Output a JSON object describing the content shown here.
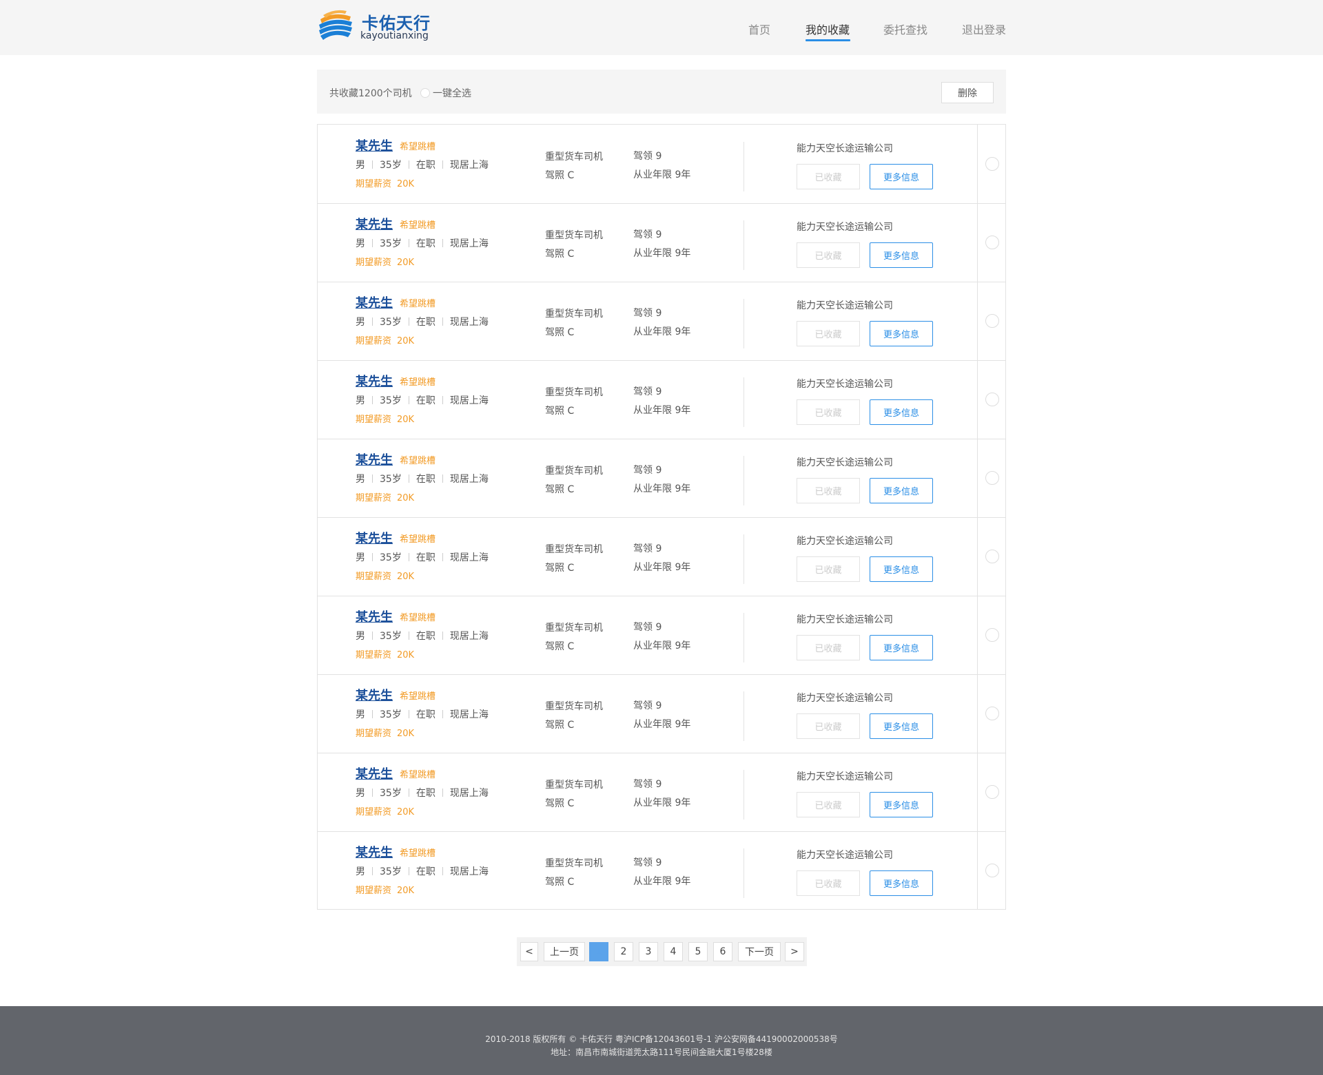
{
  "brand": {
    "name": "卡佑天行",
    "pinyin": "kayoutianxing"
  },
  "nav": [
    {
      "label": "首页",
      "active": false
    },
    {
      "label": "我的收藏",
      "active": true
    },
    {
      "label": "委托查找",
      "active": false
    },
    {
      "label": "退出登录",
      "active": false
    }
  ],
  "toolbar": {
    "total_text": "共收藏1200个司机",
    "select_all_label": "一键全选",
    "delete_label": "删除"
  },
  "drivers": [
    {
      "name": "某先生",
      "tag": "希望跳槽",
      "gender": "男",
      "age": "35岁",
      "status": "在职",
      "location": "现居上海",
      "salary_label": "期望薪资",
      "salary": "20K",
      "job": "重型货车司机",
      "license": "驾照  C",
      "driving_age": "驾领  9",
      "experience": "从业年限  9年",
      "company": "能力天空长途运输公司",
      "collected_label": "已收藏",
      "more_label": "更多信息"
    },
    {
      "name": "某先生",
      "tag": "希望跳槽",
      "gender": "男",
      "age": "35岁",
      "status": "在职",
      "location": "现居上海",
      "salary_label": "期望薪资",
      "salary": "20K",
      "job": "重型货车司机",
      "license": "驾照  C",
      "driving_age": "驾领  9",
      "experience": "从业年限  9年",
      "company": "能力天空长途运输公司",
      "collected_label": "已收藏",
      "more_label": "更多信息"
    },
    {
      "name": "某先生",
      "tag": "希望跳槽",
      "gender": "男",
      "age": "35岁",
      "status": "在职",
      "location": "现居上海",
      "salary_label": "期望薪资",
      "salary": "20K",
      "job": "重型货车司机",
      "license": "驾照  C",
      "driving_age": "驾领  9",
      "experience": "从业年限  9年",
      "company": "能力天空长途运输公司",
      "collected_label": "已收藏",
      "more_label": "更多信息"
    },
    {
      "name": "某先生",
      "tag": "希望跳槽",
      "gender": "男",
      "age": "35岁",
      "status": "在职",
      "location": "现居上海",
      "salary_label": "期望薪资",
      "salary": "20K",
      "job": "重型货车司机",
      "license": "驾照  C",
      "driving_age": "驾领  9",
      "experience": "从业年限  9年",
      "company": "能力天空长途运输公司",
      "collected_label": "已收藏",
      "more_label": "更多信息"
    },
    {
      "name": "某先生",
      "tag": "希望跳槽",
      "gender": "男",
      "age": "35岁",
      "status": "在职",
      "location": "现居上海",
      "salary_label": "期望薪资",
      "salary": "20K",
      "job": "重型货车司机",
      "license": "驾照  C",
      "driving_age": "驾领  9",
      "experience": "从业年限  9年",
      "company": "能力天空长途运输公司",
      "collected_label": "已收藏",
      "more_label": "更多信息"
    },
    {
      "name": "某先生",
      "tag": "希望跳槽",
      "gender": "男",
      "age": "35岁",
      "status": "在职",
      "location": "现居上海",
      "salary_label": "期望薪资",
      "salary": "20K",
      "job": "重型货车司机",
      "license": "驾照  C",
      "driving_age": "驾领  9",
      "experience": "从业年限  9年",
      "company": "能力天空长途运输公司",
      "collected_label": "已收藏",
      "more_label": "更多信息"
    },
    {
      "name": "某先生",
      "tag": "希望跳槽",
      "gender": "男",
      "age": "35岁",
      "status": "在职",
      "location": "现居上海",
      "salary_label": "期望薪资",
      "salary": "20K",
      "job": "重型货车司机",
      "license": "驾照  C",
      "driving_age": "驾领  9",
      "experience": "从业年限  9年",
      "company": "能力天空长途运输公司",
      "collected_label": "已收藏",
      "more_label": "更多信息"
    },
    {
      "name": "某先生",
      "tag": "希望跳槽",
      "gender": "男",
      "age": "35岁",
      "status": "在职",
      "location": "现居上海",
      "salary_label": "期望薪资",
      "salary": "20K",
      "job": "重型货车司机",
      "license": "驾照  C",
      "driving_age": "驾领  9",
      "experience": "从业年限  9年",
      "company": "能力天空长途运输公司",
      "collected_label": "已收藏",
      "more_label": "更多信息"
    },
    {
      "name": "某先生",
      "tag": "希望跳槽",
      "gender": "男",
      "age": "35岁",
      "status": "在职",
      "location": "现居上海",
      "salary_label": "期望薪资",
      "salary": "20K",
      "job": "重型货车司机",
      "license": "驾照  C",
      "driving_age": "驾领  9",
      "experience": "从业年限  9年",
      "company": "能力天空长途运输公司",
      "collected_label": "已收藏",
      "more_label": "更多信息"
    },
    {
      "name": "某先生",
      "tag": "希望跳槽",
      "gender": "男",
      "age": "35岁",
      "status": "在职",
      "location": "现居上海",
      "salary_label": "期望薪资",
      "salary": "20K",
      "job": "重型货车司机",
      "license": "驾照  C",
      "driving_age": "驾领  9",
      "experience": "从业年限  9年",
      "company": "能力天空长途运输公司",
      "collected_label": "已收藏",
      "more_label": "更多信息"
    }
  ],
  "pagination": {
    "first": "<",
    "prev": "上一页",
    "pages": [
      "1",
      "2",
      "3",
      "4",
      "5",
      "6"
    ],
    "current_page": "1",
    "next": "下一页",
    "last": ">"
  },
  "footer": {
    "line1": "2010-2018 版权所有 © 卡佑天行 粤沪ICP备12043601号-1 沪公安网备44190002000538号",
    "line2": "地址：南昌市南城街道莞太路111号民间金融大厦1号楼28楼"
  },
  "colors": {
    "accent": "#2a8ee6",
    "brand_blue": "#1b4f9a",
    "highlight_orange": "#f29b26",
    "footer_bg": "#62656b"
  }
}
